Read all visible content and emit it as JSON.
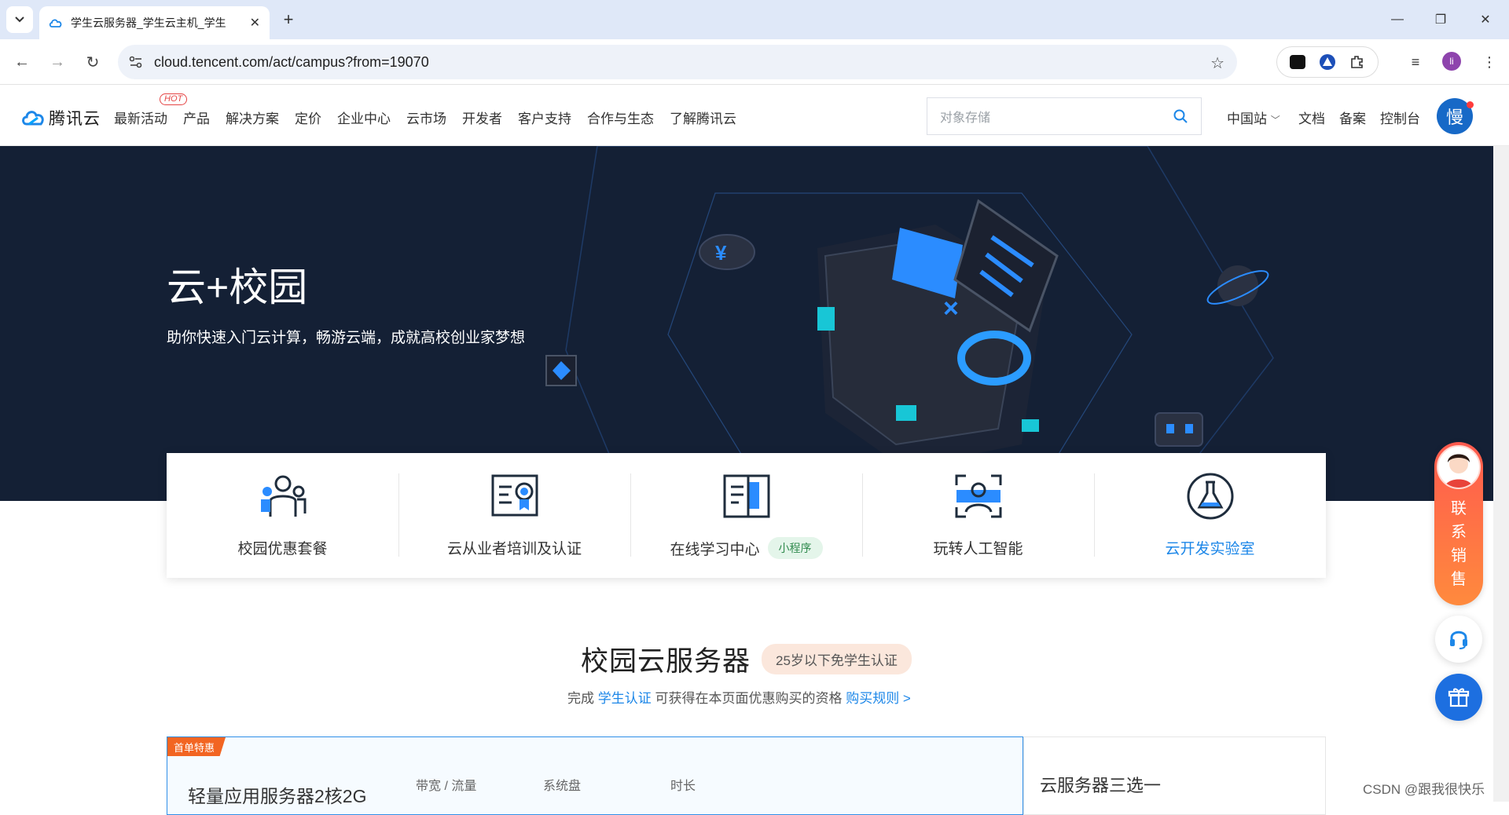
{
  "browser": {
    "tab_title": "学生云服务器_学生云主机_学生",
    "url": "cloud.tencent.com/act/campus?from=19070",
    "profile_initial": "li"
  },
  "header": {
    "logo_text": "腾讯云",
    "hot_badge": "HOT",
    "nav": [
      "最新活动",
      "产品",
      "解决方案",
      "定价",
      "企业中心",
      "云市场",
      "开发者",
      "客户支持",
      "合作与生态",
      "了解腾讯云"
    ],
    "search_placeholder": "对象存储",
    "region": "中国站",
    "docs": "文档",
    "record": "备案",
    "console": "控制台",
    "avatar_char": "慢"
  },
  "hero": {
    "title": "云+校园",
    "subtitle": "助你快速入门云计算，畅游云端，成就高校创业家梦想"
  },
  "features": [
    {
      "label": "校园优惠套餐",
      "icon": "people-icon",
      "active": false
    },
    {
      "label": "云从业者培训及认证",
      "icon": "certificate-icon",
      "active": false
    },
    {
      "label": "在线学习中心",
      "icon": "book-icon",
      "badge": "小程序",
      "active": false
    },
    {
      "label": "玩转人工智能",
      "icon": "face-scan-icon",
      "active": false
    },
    {
      "label": "云开发实验室",
      "icon": "flask-icon",
      "active": true
    }
  ],
  "campus": {
    "title": "校园云服务器",
    "badge": "25岁以下免学生认证",
    "sub_prefix": "完成",
    "sub_link1": "学生认证",
    "sub_middle": "可获得在本页面优惠购买的资格",
    "sub_link2": "购买规则 >"
  },
  "plan": {
    "tag": "首单特惠",
    "name": "轻量应用服务器2核2G",
    "col1": "带宽 / 流量",
    "col2": "系统盘",
    "col3": "时长"
  },
  "side": {
    "title": "云服务器三选一"
  },
  "contact": {
    "text": [
      "联",
      "系",
      "销",
      "售"
    ]
  },
  "watermark": "CSDN @跟我很快乐",
  "colors": {
    "hero_bg": "#142035",
    "accent_blue": "#1d87e8",
    "contact_gradient": "#ff5a4e"
  }
}
